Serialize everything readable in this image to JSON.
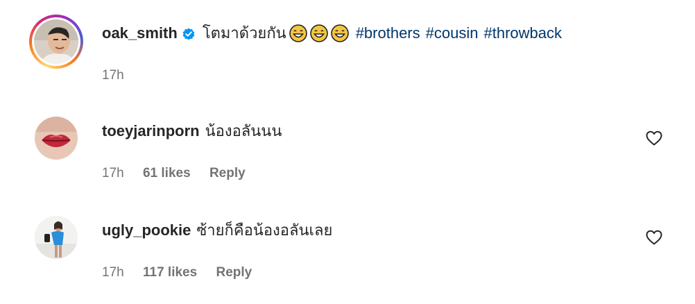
{
  "post": {
    "username": "oak_smith",
    "verified_icon": "verified-badge-icon",
    "caption": "โตมาด้วยกัน",
    "emojis": [
      "grinning-face-icon",
      "grinning-face-icon",
      "grinning-face-icon"
    ],
    "hashtags": [
      "#brothers",
      "#cousin",
      "#throwback"
    ],
    "time": "17h"
  },
  "comments": [
    {
      "username": "toeyjarinporn",
      "text": "น้องอลันนน",
      "time": "17h",
      "likes": "61 likes",
      "reply_label": "Reply",
      "like_icon": "heart-outline-icon"
    },
    {
      "username": "ugly_pookie",
      "text": "ซ้ายก็คือน้องอลันเลย",
      "time": "17h",
      "likes": "117 likes",
      "reply_label": "Reply",
      "like_icon": "heart-outline-icon"
    }
  ],
  "colors": {
    "text": "#262626",
    "secondary": "#737373",
    "hashtag": "#00376b",
    "verified": "#0095f6"
  }
}
